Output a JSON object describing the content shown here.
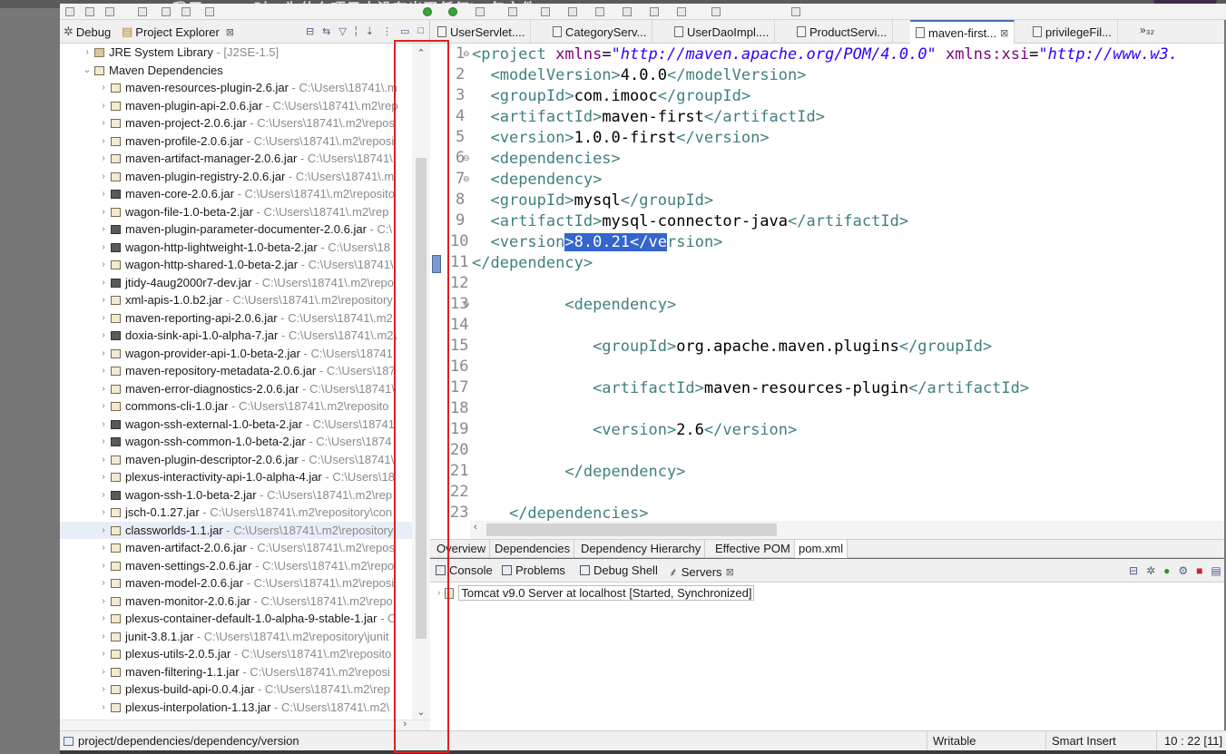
{
  "tree_icon_classes": [
    "lib",
    "",
    "",
    "",
    "",
    "",
    "",
    "",
    "dark",
    "",
    "dark",
    "dark",
    "",
    "dark",
    "",
    "",
    "dark",
    "",
    "",
    "",
    "",
    "dark",
    "dark",
    "",
    "",
    "dark",
    "",
    "",
    "",
    "",
    "",
    "",
    "",
    "",
    "",
    "",
    "",
    "",
    ""
  ],
  "left_panel": {
    "tab_debug": "Debug",
    "tab_project_explorer": "Project Explorer",
    "tree": [
      {
        "name": "JRE System Library",
        "path": "[J2SE-1.5]",
        "indent": 1,
        "arrow": "›",
        "selected": false
      },
      {
        "name": "Maven Dependencies",
        "path": "",
        "indent": 1,
        "arrow": "⌄",
        "selected": false
      },
      {
        "name": "maven-resources-plugin-2.6.jar",
        "path": "C:\\Users\\18741\\.m",
        "indent": 2,
        "arrow": "›",
        "selected": false
      },
      {
        "name": "maven-plugin-api-2.0.6.jar",
        "path": "C:\\Users\\18741\\.m2\\rep",
        "indent": 2,
        "arrow": "›",
        "selected": false
      },
      {
        "name": "maven-project-2.0.6.jar",
        "path": "C:\\Users\\18741\\.m2\\repos",
        "indent": 2,
        "arrow": "›",
        "selected": false
      },
      {
        "name": "maven-profile-2.0.6.jar",
        "path": "C:\\Users\\18741\\.m2\\reposi",
        "indent": 2,
        "arrow": "›",
        "selected": false
      },
      {
        "name": "maven-artifact-manager-2.0.6.jar",
        "path": "C:\\Users\\18741\\.",
        "indent": 2,
        "arrow": "›",
        "selected": false
      },
      {
        "name": "maven-plugin-registry-2.0.6.jar",
        "path": "C:\\Users\\18741\\.m",
        "indent": 2,
        "arrow": "›",
        "selected": false
      },
      {
        "name": "maven-core-2.0.6.jar",
        "path": "C:\\Users\\18741\\.m2\\reposito",
        "indent": 2,
        "arrow": "›",
        "selected": false
      },
      {
        "name": "wagon-file-1.0-beta-2.jar",
        "path": "C:\\Users\\18741\\.m2\\rep",
        "indent": 2,
        "arrow": "›",
        "selected": false
      },
      {
        "name": "maven-plugin-parameter-documenter-2.0.6.jar",
        "path": "C:\\",
        "indent": 2,
        "arrow": "›",
        "selected": false
      },
      {
        "name": "wagon-http-lightweight-1.0-beta-2.jar",
        "path": "C:\\Users\\18",
        "indent": 2,
        "arrow": "›",
        "selected": false
      },
      {
        "name": "wagon-http-shared-1.0-beta-2.jar",
        "path": "C:\\Users\\18741\\",
        "indent": 2,
        "arrow": "›",
        "selected": false
      },
      {
        "name": "jtidy-4aug2000r7-dev.jar",
        "path": "C:\\Users\\18741\\.m2\\repo",
        "indent": 2,
        "arrow": "›",
        "selected": false
      },
      {
        "name": "xml-apis-1.0.b2.jar",
        "path": "C:\\Users\\18741\\.m2\\repository",
        "indent": 2,
        "arrow": "›",
        "selected": false
      },
      {
        "name": "maven-reporting-api-2.0.6.jar",
        "path": "C:\\Users\\18741\\.m2",
        "indent": 2,
        "arrow": "›",
        "selected": false
      },
      {
        "name": "doxia-sink-api-1.0-alpha-7.jar",
        "path": "C:\\Users\\18741\\.m2\\",
        "indent": 2,
        "arrow": "›",
        "selected": false
      },
      {
        "name": "wagon-provider-api-1.0-beta-2.jar",
        "path": "C:\\Users\\18741",
        "indent": 2,
        "arrow": "›",
        "selected": false
      },
      {
        "name": "maven-repository-metadata-2.0.6.jar",
        "path": "C:\\Users\\187",
        "indent": 2,
        "arrow": "›",
        "selected": false
      },
      {
        "name": "maven-error-diagnostics-2.0.6.jar",
        "path": "C:\\Users\\18741\\",
        "indent": 2,
        "arrow": "›",
        "selected": false
      },
      {
        "name": "commons-cli-1.0.jar",
        "path": "C:\\Users\\18741\\.m2\\reposito",
        "indent": 2,
        "arrow": "›",
        "selected": false
      },
      {
        "name": "wagon-ssh-external-1.0-beta-2.jar",
        "path": "C:\\Users\\18741",
        "indent": 2,
        "arrow": "›",
        "selected": false
      },
      {
        "name": "wagon-ssh-common-1.0-beta-2.jar",
        "path": "C:\\Users\\1874",
        "indent": 2,
        "arrow": "›",
        "selected": false
      },
      {
        "name": "maven-plugin-descriptor-2.0.6.jar",
        "path": "C:\\Users\\18741\\",
        "indent": 2,
        "arrow": "›",
        "selected": false
      },
      {
        "name": "plexus-interactivity-api-1.0-alpha-4.jar",
        "path": "C:\\Users\\18",
        "indent": 2,
        "arrow": "›",
        "selected": false
      },
      {
        "name": "wagon-ssh-1.0-beta-2.jar",
        "path": "C:\\Users\\18741\\.m2\\rep",
        "indent": 2,
        "arrow": "›",
        "selected": false
      },
      {
        "name": "jsch-0.1.27.jar",
        "path": "C:\\Users\\18741\\.m2\\repository\\con",
        "indent": 2,
        "arrow": "›",
        "selected": false
      },
      {
        "name": "classworlds-1.1.jar",
        "path": "C:\\Users\\18741\\.m2\\repository",
        "indent": 2,
        "arrow": "›",
        "selected": true
      },
      {
        "name": "maven-artifact-2.0.6.jar",
        "path": "C:\\Users\\18741\\.m2\\repos",
        "indent": 2,
        "arrow": "›",
        "selected": false
      },
      {
        "name": "maven-settings-2.0.6.jar",
        "path": "C:\\Users\\18741\\.m2\\repo",
        "indent": 2,
        "arrow": "›",
        "selected": false
      },
      {
        "name": "maven-model-2.0.6.jar",
        "path": "C:\\Users\\18741\\.m2\\reposi",
        "indent": 2,
        "arrow": "›",
        "selected": false
      },
      {
        "name": "maven-monitor-2.0.6.jar",
        "path": "C:\\Users\\18741\\.m2\\repo",
        "indent": 2,
        "arrow": "›",
        "selected": false
      },
      {
        "name": "plexus-container-default-1.0-alpha-9-stable-1.jar",
        "path": "C",
        "indent": 2,
        "arrow": "›",
        "selected": false
      },
      {
        "name": "junit-3.8.1.jar",
        "path": "C:\\Users\\18741\\.m2\\repository\\junit",
        "indent": 2,
        "arrow": "›",
        "selected": false
      },
      {
        "name": "plexus-utils-2.0.5.jar",
        "path": "C:\\Users\\18741\\.m2\\reposito",
        "indent": 2,
        "arrow": "›",
        "selected": false
      },
      {
        "name": "maven-filtering-1.1.jar",
        "path": "C:\\Users\\18741\\.m2\\reposi",
        "indent": 2,
        "arrow": "›",
        "selected": false
      },
      {
        "name": "plexus-build-api-0.0.4.jar",
        "path": "C:\\Users\\18741\\.m2\\rep",
        "indent": 2,
        "arrow": "›",
        "selected": false
      },
      {
        "name": "plexus-interpolation-1.13.jar",
        "path": "C:\\Users\\18741\\.m2\\",
        "indent": 2,
        "arrow": "›",
        "selected": false
      }
    ]
  },
  "editor": {
    "tabs": [
      {
        "label": "UserServlet....",
        "active": false
      },
      {
        "label": "CategoryServ...",
        "active": false
      },
      {
        "label": "UserDaoImpl....",
        "active": false
      },
      {
        "label": "ProductServi...",
        "active": false
      },
      {
        "label": "maven-first...",
        "active": true,
        "close": "⊠"
      },
      {
        "label": "privilegeFil...",
        "active": false
      }
    ],
    "more_tabs": "»₃₂",
    "line_numbers": [
      "1",
      "2",
      "3",
      "4",
      "5",
      "6",
      "7",
      "8",
      "9",
      "10",
      "11",
      "12",
      "13",
      "14",
      "15",
      "16",
      "17",
      "18",
      "19",
      "20",
      "21",
      "22",
      "23"
    ],
    "fold_marks": {
      "1": "⊖",
      "6": "⊖",
      "7": "⊖",
      "13": "⊖"
    },
    "code_lines": [
      [
        [
          "tag",
          "<project "
        ],
        [
          "attr",
          "xmlns"
        ],
        [
          "txt",
          "="
        ],
        [
          "val",
          "\"http://maven.apache.org/POM/4.0.0\""
        ],
        [
          "txt",
          " "
        ],
        [
          "attr",
          "xmlns:xsi"
        ],
        [
          "txt",
          "="
        ],
        [
          "val",
          "\"http://www.w3."
        ]
      ],
      [
        [
          "txt",
          "  "
        ],
        [
          "tag",
          "<modelVersion>"
        ],
        [
          "txt",
          "4.0.0"
        ],
        [
          "tag",
          "</modelVersion>"
        ]
      ],
      [
        [
          "txt",
          "  "
        ],
        [
          "tag",
          "<groupId>"
        ],
        [
          "txt",
          "com.imooc"
        ],
        [
          "tag",
          "</groupId>"
        ]
      ],
      [
        [
          "txt",
          "  "
        ],
        [
          "tag",
          "<artifactId>"
        ],
        [
          "txt",
          "maven-first"
        ],
        [
          "tag",
          "</artifactId>"
        ]
      ],
      [
        [
          "txt",
          "  "
        ],
        [
          "tag",
          "<version>"
        ],
        [
          "txt",
          "1.0.0-first"
        ],
        [
          "tag",
          "</version>"
        ]
      ],
      [
        [
          "txt",
          "  "
        ],
        [
          "tag",
          "<dependencies>"
        ]
      ],
      [
        [
          "txt",
          "  "
        ],
        [
          "tag",
          "<dependency>"
        ]
      ],
      [
        [
          "txt",
          "  "
        ],
        [
          "tag",
          "<groupId>"
        ],
        [
          "txt",
          "mysql"
        ],
        [
          "tag",
          "</groupId>"
        ]
      ],
      [
        [
          "txt",
          "  "
        ],
        [
          "tag",
          "<artifactId>"
        ],
        [
          "txt",
          "mysql-connector-java"
        ],
        [
          "tag",
          "</artifactId>"
        ]
      ],
      [
        [
          "txt",
          "  "
        ],
        [
          "tag",
          "<version"
        ],
        [
          "hltag",
          ">"
        ],
        [
          "hl",
          "8.0.21"
        ],
        [
          "hltag",
          "</ve"
        ],
        [
          "tag",
          "rsion>"
        ]
      ],
      [
        [
          "tag",
          "</dependency>"
        ]
      ],
      [
        [
          "txt",
          ""
        ]
      ],
      [
        [
          "txt",
          "          "
        ],
        [
          "tag",
          "<dependency>"
        ]
      ],
      [
        [
          "txt",
          ""
        ]
      ],
      [
        [
          "txt",
          "             "
        ],
        [
          "tag",
          "<groupId>"
        ],
        [
          "txt",
          "org.apache.maven.plugins"
        ],
        [
          "tag",
          "</groupId>"
        ]
      ],
      [
        [
          "txt",
          ""
        ]
      ],
      [
        [
          "txt",
          "             "
        ],
        [
          "tag",
          "<artifactId>"
        ],
        [
          "txt",
          "maven-resources-plugin"
        ],
        [
          "tag",
          "</artifactId>"
        ]
      ],
      [
        [
          "txt",
          ""
        ]
      ],
      [
        [
          "txt",
          "             "
        ],
        [
          "tag",
          "<version>"
        ],
        [
          "txt",
          "2.6"
        ],
        [
          "tag",
          "</version>"
        ]
      ],
      [
        [
          "txt",
          ""
        ]
      ],
      [
        [
          "txt",
          "          "
        ],
        [
          "tag",
          "</dependency>"
        ]
      ],
      [
        [
          "txt",
          ""
        ]
      ],
      [
        [
          "txt",
          "    "
        ],
        [
          "tag",
          "</dependencies>"
        ]
      ]
    ]
  },
  "pom_tabs": [
    "Overview",
    "Dependencies",
    "Dependency Hierarchy",
    "Effective POM",
    "pom.xml"
  ],
  "console": {
    "tabs": [
      "Console",
      "Problems",
      "Debug Shell",
      "Servers"
    ],
    "server_row": "Tomcat v9.0 Server at localhost  [Started, Synchronized]"
  },
  "status": {
    "path": "project/dependencies/dependency/version",
    "writable": "Writable",
    "insert_mode": "Smart Insert",
    "position": "10 : 22 [11]"
  },
  "top_cut_text": "我用maven时，为什么项目中没有出现任何jar包文件"
}
